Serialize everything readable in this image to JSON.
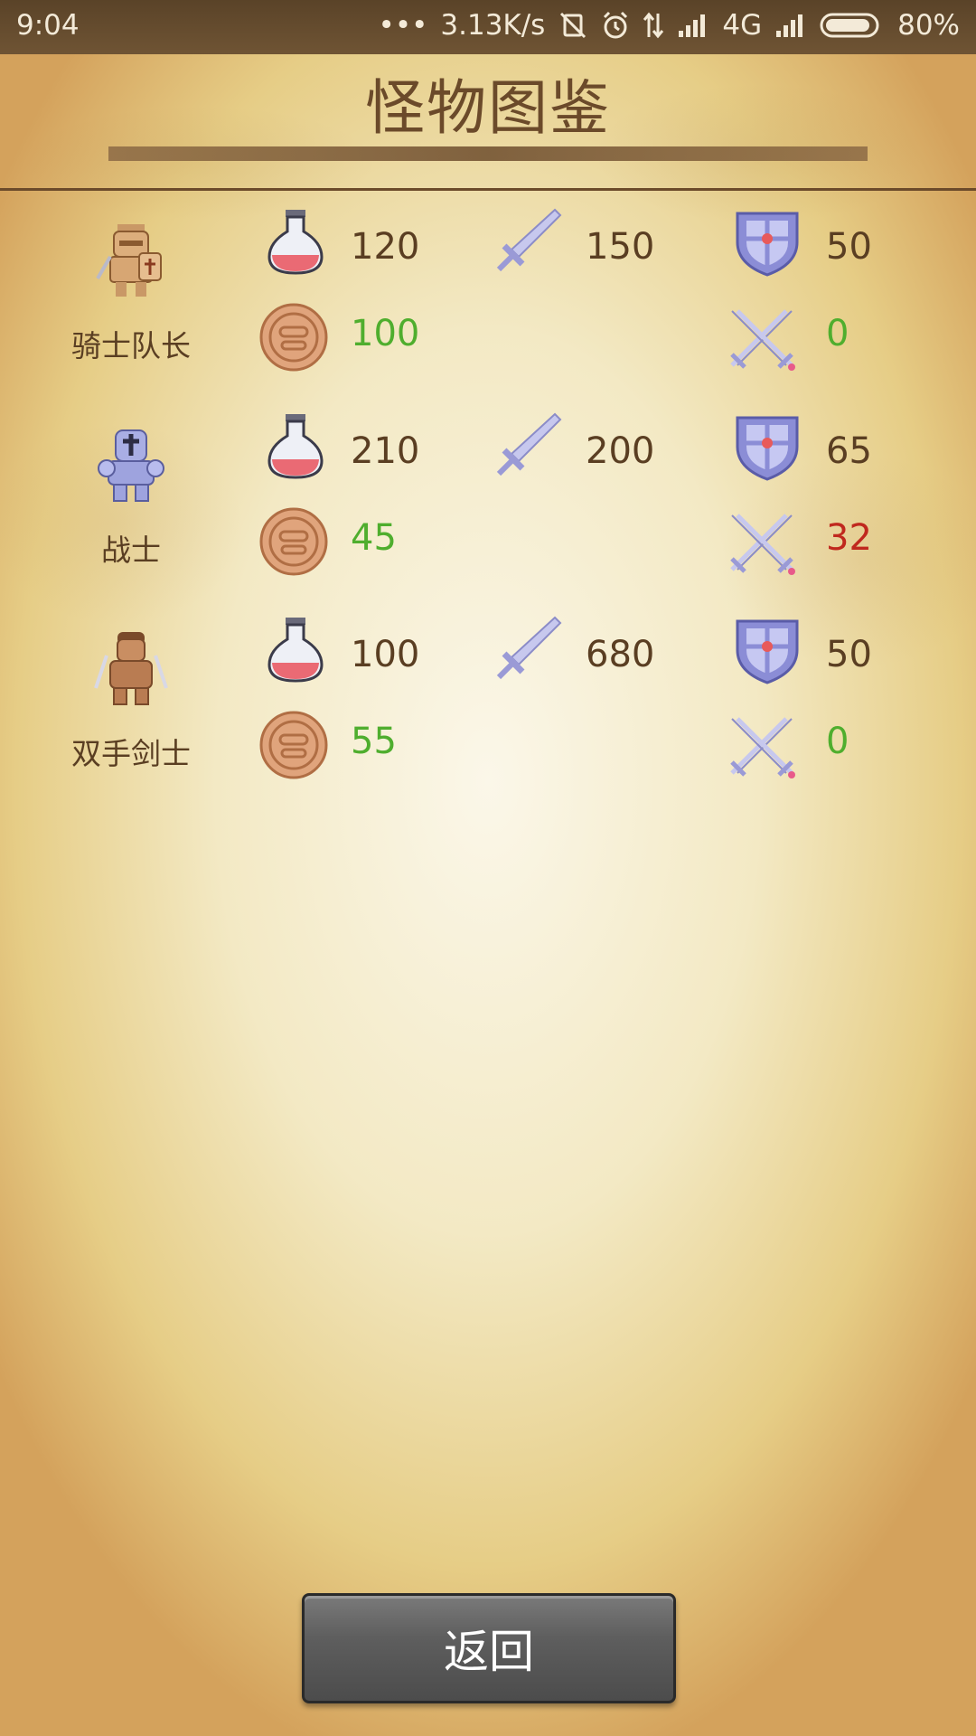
{
  "status_bar": {
    "time": "9:04",
    "dots": "•••",
    "network_speed": "3.13K/s",
    "network_type": "4G",
    "battery": "80%"
  },
  "title": "怪物图鉴",
  "monsters": [
    {
      "name": "骑士队长",
      "hp": "120",
      "attack": "150",
      "defense": "50",
      "gold": "100",
      "damage": "0",
      "damage_color": "green",
      "sprite": "knight-captain"
    },
    {
      "name": "战士",
      "hp": "210",
      "attack": "200",
      "defense": "65",
      "gold": "45",
      "damage": "32",
      "damage_color": "red",
      "sprite": "warrior"
    },
    {
      "name": "双手剑士",
      "hp": "100",
      "attack": "680",
      "defense": "50",
      "gold": "55",
      "damage": "0",
      "damage_color": "green",
      "sprite": "two-handed-swordsman"
    }
  ],
  "icons": {
    "hp": "potion-icon",
    "attack": "sword-icon",
    "defense": "shield-icon",
    "gold": "coin-icon",
    "damage": "crossed-swords-icon"
  },
  "colors": {
    "text_brown": "#5a3e22",
    "gold_green": "#4fae2e",
    "damage_red": "#c0281e"
  },
  "back_button": "返回"
}
